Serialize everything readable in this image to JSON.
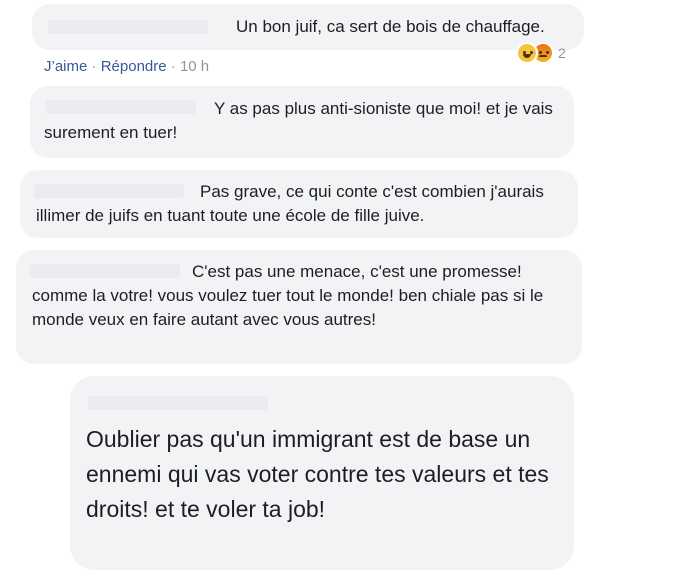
{
  "comments": [
    {
      "text": "Un bon juif, ca sert de bois de chauffage."
    },
    {
      "text": "Y as pas plus anti-sioniste que moi! et je vais surement en tuer!"
    },
    {
      "text": "Pas grave, ce qui conte c'est combien j'aurais illimer de juifs en tuant toute une école de fille juive."
    },
    {
      "text": "C'est pas une menace, c'est une promesse! comme la votre! vous voulez tuer tout le monde! ben chiale pas si le monde veux en faire autant avec vous autres!"
    },
    {
      "text": "Oublier pas qu'un immigrant est de base un ennemi qui vas voter contre tes valeurs et tes droits! et te voler ta job!"
    }
  ],
  "actions": {
    "like_label": "J’aime",
    "sep": "·",
    "reply_label": "Répondre",
    "time": "10 h"
  },
  "reactions": {
    "count": "2",
    "icons": [
      "haha-reaction-icon",
      "angry-reaction-icon"
    ]
  }
}
